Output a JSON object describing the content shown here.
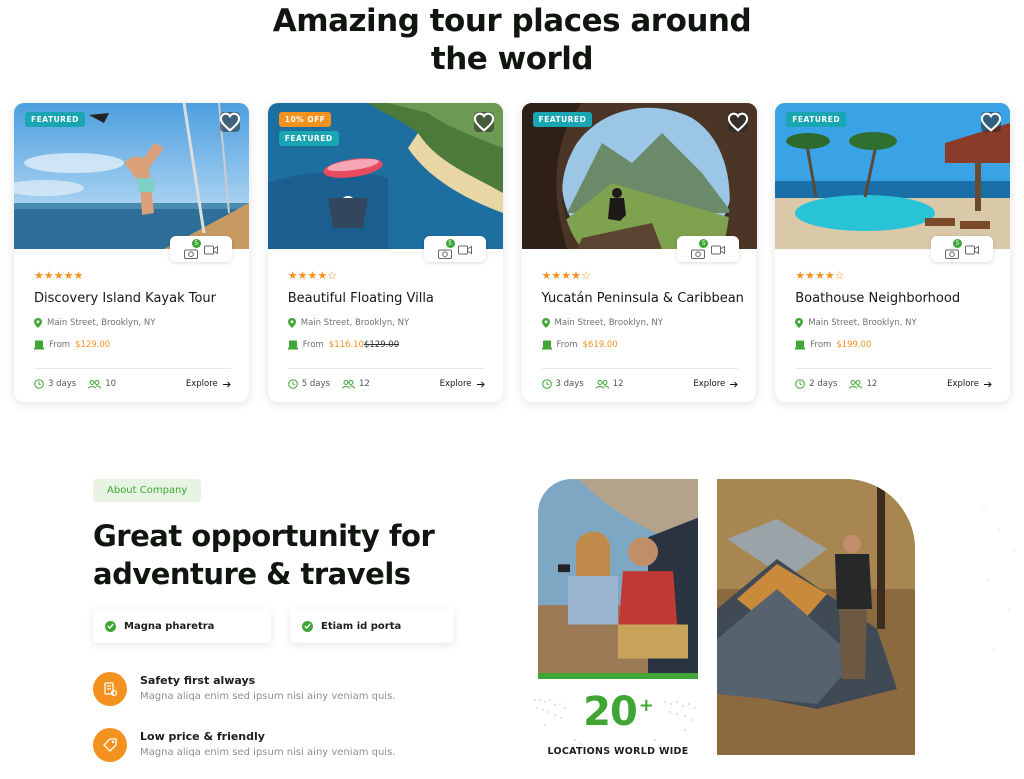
{
  "headline": {
    "line1": "Amazing tour places around",
    "line2": "the world"
  },
  "tours": [
    {
      "badges": [
        "FEATURED"
      ],
      "stars": "★★★★★",
      "title": "Discovery Island Kayak Tour",
      "location": "Main Street, Brooklyn, NY",
      "price_prefix": "From",
      "price": "$129.00",
      "old_price": "",
      "duration": "3 days",
      "people": "10",
      "explore": "Explore",
      "media_count": "5"
    },
    {
      "badges": [
        "10% OFF",
        "FEATURED"
      ],
      "stars": "★★★★☆",
      "title": "Beautiful Floating Villa",
      "location": "Main Street, Brooklyn, NY",
      "price_prefix": "From",
      "price": "$116.10",
      "old_price": "$129.00",
      "duration": "5 days",
      "people": "12",
      "explore": "Explore",
      "media_count": "5"
    },
    {
      "badges": [
        "FEATURED"
      ],
      "stars": "★★★★☆",
      "title": "Yucatán Peninsula & Caribbean",
      "location": "Main Street, Brooklyn, NY",
      "price_prefix": "From",
      "price": "$619.00",
      "old_price": "",
      "duration": "3 days",
      "people": "12",
      "explore": "Explore",
      "media_count": "5"
    },
    {
      "badges": [
        "FEATURED"
      ],
      "stars": "★★★★☆",
      "title": "Boathouse Neighborhood",
      "location": "Main Street, Brooklyn, NY",
      "price_prefix": "From",
      "price": "$199.00",
      "old_price": "",
      "duration": "2 days",
      "people": "12",
      "explore": "Explore",
      "media_count": "5"
    }
  ],
  "about": {
    "tag": "About Company",
    "heading_line1": "Great opportunity for",
    "heading_line2": "adventure & travels",
    "pills": [
      "Magna pharetra",
      "Etiam id porta"
    ],
    "features": [
      {
        "title": "Safety first always",
        "desc": "Magna aliqa enim sed ipsum nisi ainy veniam quis.",
        "icon": "safety-icon"
      },
      {
        "title": "Low price & friendly",
        "desc": "Magna aliqa enim sed ipsum nisi ainy veniam quis.",
        "icon": "price-tag-icon"
      }
    ],
    "stat_number": "20",
    "stat_suffix": "+",
    "stat_label": "LOCATIONS WORLD WIDE"
  },
  "colors": {
    "accent": "#3fa535",
    "orange": "#f3921f",
    "teal": "#1aa5b2"
  }
}
